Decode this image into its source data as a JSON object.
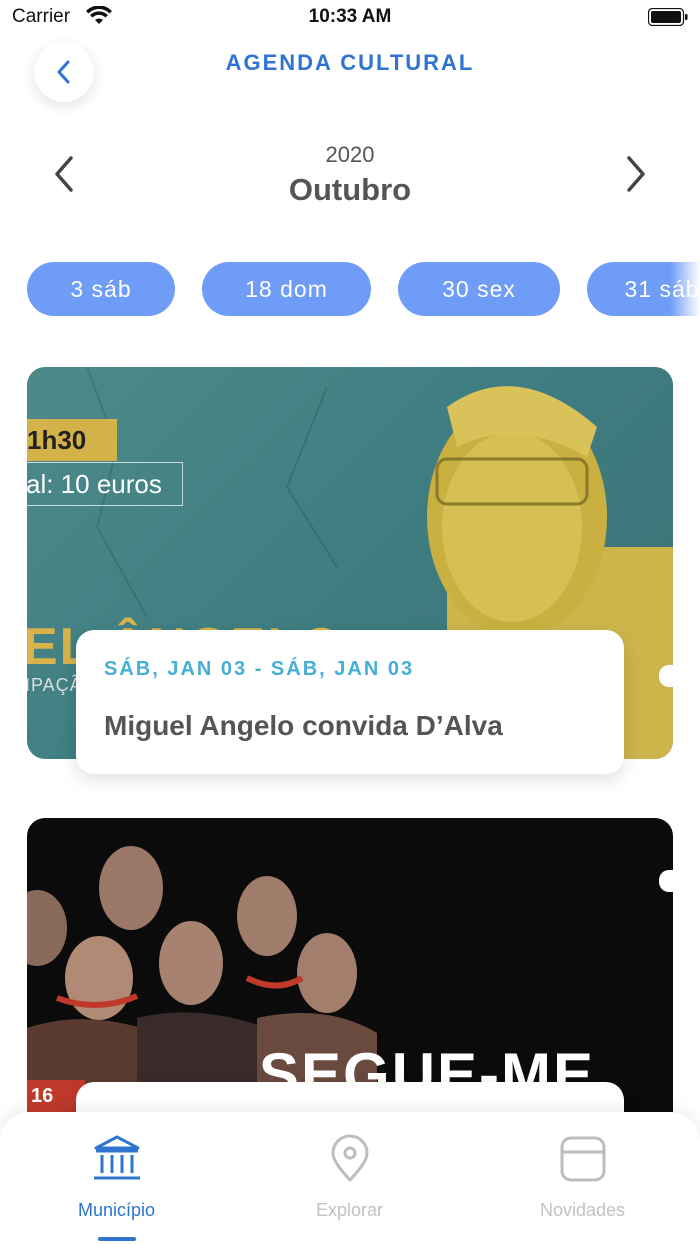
{
  "status_bar": {
    "carrier": "Carrier",
    "time": "10:33 AM"
  },
  "header": {
    "title": "AGENDA CULTURAL"
  },
  "calendar": {
    "year": "2020",
    "month": "Outubro"
  },
  "dates": [
    "3 sáb",
    "18 dom",
    "30 sex",
    "31 sáb"
  ],
  "events": [
    {
      "date_range": "SÁB, JAN 03 - SÁB, JAN 03",
      "title": "Miguel Angelo convida D’Alva",
      "poster_time": "1h30",
      "poster_price": "al: 10 euros",
      "poster_name": "EL  ÂNGELO",
      "poster_sub": "IPAÇÃ"
    },
    {
      "poster_title": "SEGUE-ME",
      "poster_tag": "16"
    }
  ],
  "tabs": [
    {
      "label": "Município",
      "icon": "building-icon",
      "active": true
    },
    {
      "label": "Explorar",
      "icon": "map-pin-icon",
      "active": false
    },
    {
      "label": "Novidades",
      "icon": "card-icon",
      "active": false
    }
  ],
  "colors": {
    "accent": "#2f74d0",
    "pill": "#6f9cf6",
    "event_date": "#47aed6",
    "inactive": "#c2c2c2"
  }
}
